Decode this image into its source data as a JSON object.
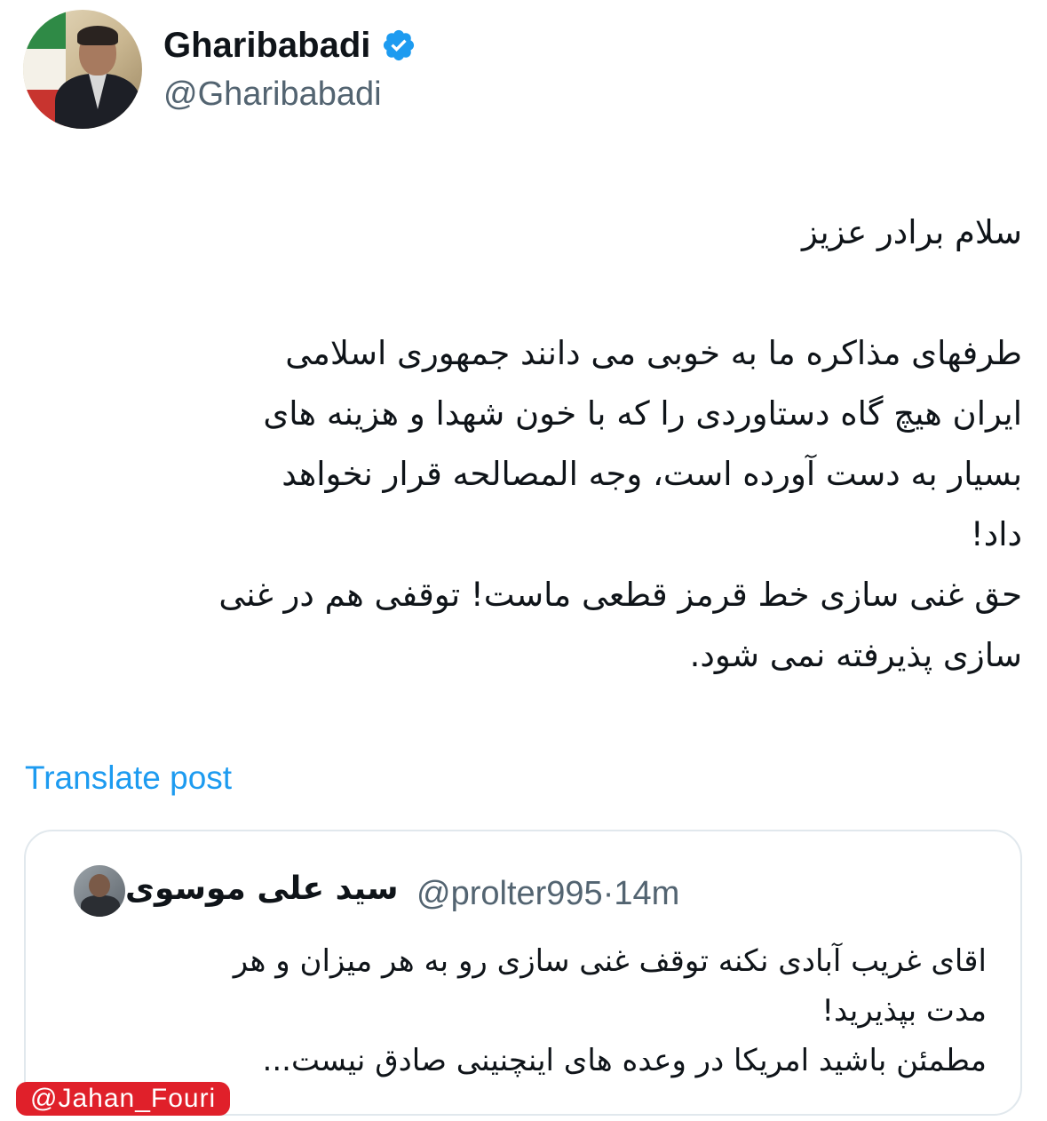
{
  "tweet": {
    "author_name": "Gharibabadi",
    "author_handle": "@Gharibabadi",
    "verified": true,
    "body": {
      "greeting": "سلام برادر عزیز",
      "paragraph_1_line_1": "طرفهای مذاکره ما به خوبی می دانند جمهوری اسلامی",
      "paragraph_1_line_2": "ایران هیچ گاه دستاوردی را که با خون شهدا و هزینه های",
      "paragraph_1_line_3": "بسیار به دست آورده است، وجه المصالحه قرار نخواهد",
      "paragraph_1_line_4": "داد!",
      "paragraph_2_line_1": "حق غنی سازی خط قرمز قطعی ماست! توقفی هم در غنی",
      "paragraph_2_line_2": "سازی پذیرفته نمی شود."
    },
    "translate_label": "Translate post"
  },
  "quoted_tweet": {
    "author_name": "سید علی موسوی",
    "author_handle": "@prolter995",
    "separator": "·",
    "time": "14m",
    "line_1": "اقای غریب آبادی نکنه توقف غنی سازی رو به هر میزان و هر",
    "line_2": "مدت بپذیرید!",
    "line_3": "مطمئن باشید امریکا در وعده های اینچنینی صادق نیست..."
  },
  "watermark": "@Jahan_Fouri",
  "colors": {
    "link": "#1d9bf0",
    "verified": "#1d9bf0",
    "secondary_text": "#536471",
    "watermark_bg": "#e0202a"
  },
  "icons": {
    "verified": "verified-badge-icon"
  }
}
